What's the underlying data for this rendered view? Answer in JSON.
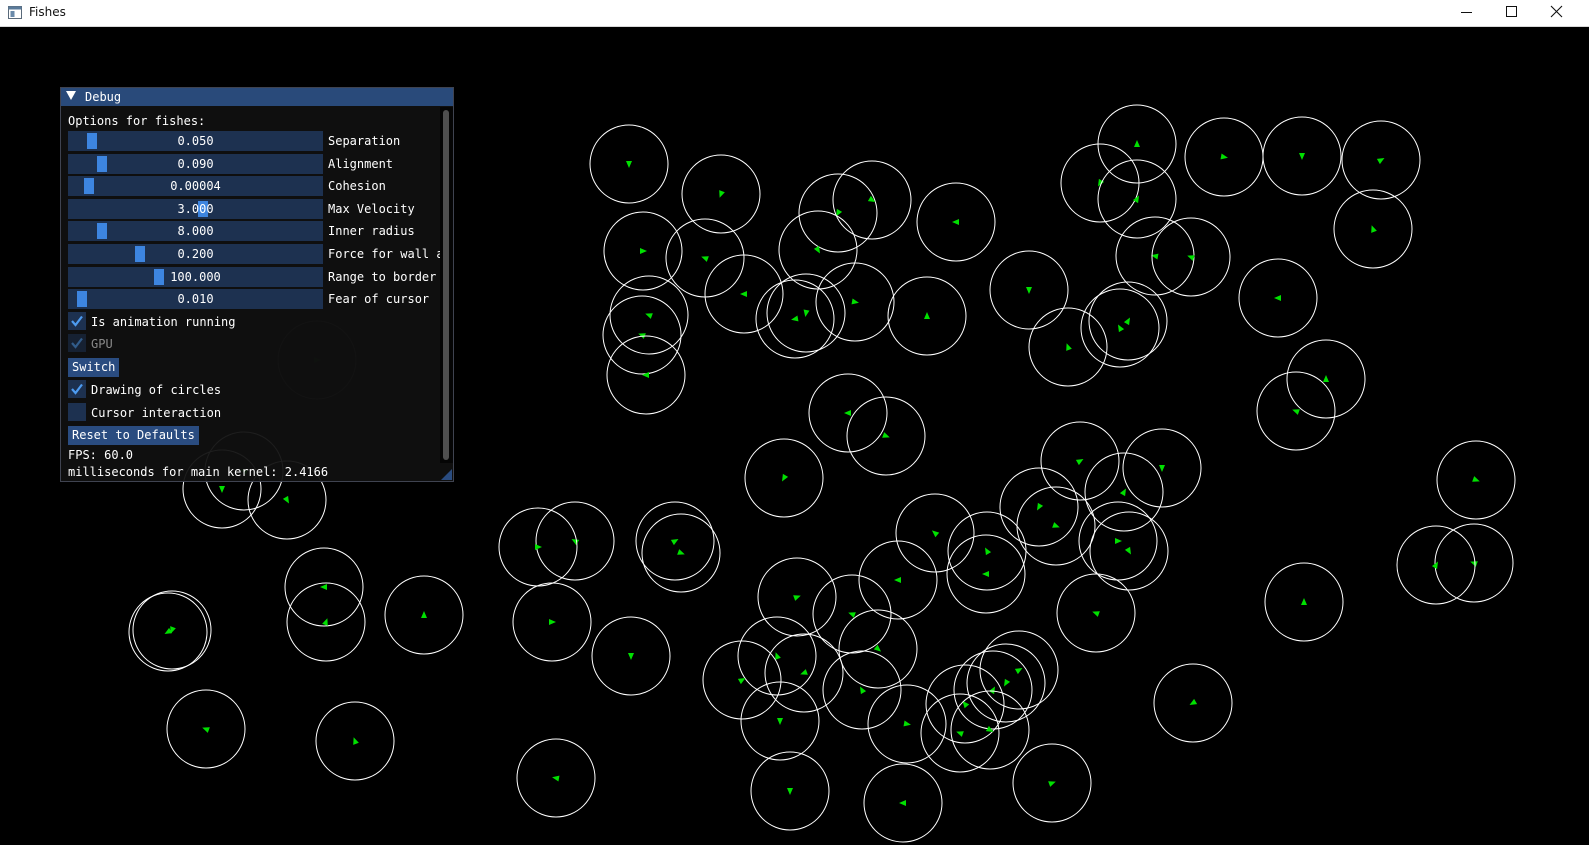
{
  "window": {
    "title": "Fishes"
  },
  "debug": {
    "title": "Debug",
    "options_label": "Options for fishes:",
    "sliders": [
      {
        "value": "0.050",
        "label": "Separation",
        "fraction": 0.07
      },
      {
        "value": "0.090",
        "label": "Alignment",
        "fraction": 0.11
      },
      {
        "value": "0.00004",
        "label": "Cohesion",
        "fraction": 0.06
      },
      {
        "value": "3.000",
        "label": "Max Velocity",
        "fraction": 0.53
      },
      {
        "value": "8.000",
        "label": "Inner radius",
        "fraction": 0.11
      },
      {
        "value": "0.200",
        "label": "Force for wall a",
        "fraction": 0.27
      },
      {
        "value": "100.000",
        "label": "Range to border",
        "fraction": 0.35
      },
      {
        "value": "0.010",
        "label": "Fear of cursor",
        "fraction": 0.03
      }
    ],
    "checkboxes": {
      "animation": {
        "label": "Is animation running",
        "checked": true
      },
      "gpu": {
        "label": "GPU",
        "checked": true
      },
      "circles": {
        "label": "Drawing of circles",
        "checked": true
      },
      "cursor": {
        "label": "Cursor interaction",
        "checked": false
      }
    },
    "switch_label": "Switch",
    "reset_label": "Reset to Defaults",
    "fps": "FPS: 60.0",
    "kernel": "milliseconds for main kernel: 2.4166"
  },
  "colors": {
    "fish": "#00e000",
    "circle": "#ffffff",
    "header": "#294a7a",
    "accent": "#3d85e0"
  }
}
